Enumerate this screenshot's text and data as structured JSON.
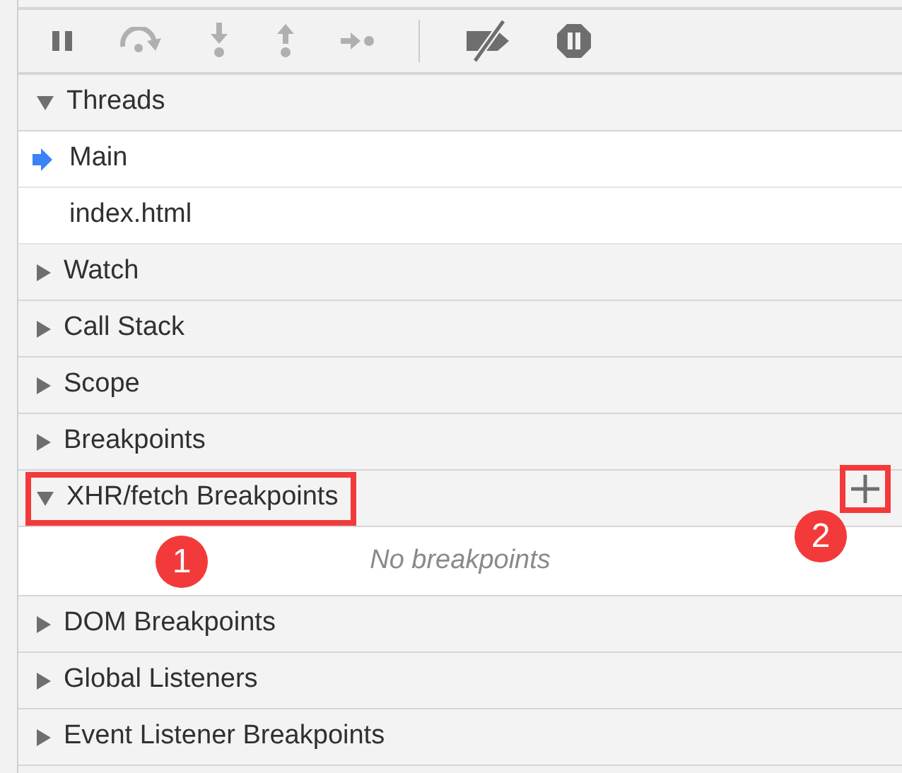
{
  "toolbar": [
    [
      {
        "kind": "pause",
        "disabled": false
      },
      {
        "kind": "step-over",
        "disabled": true
      },
      {
        "kind": "step-into",
        "disabled": true
      },
      {
        "kind": "step-out",
        "disabled": true
      },
      {
        "kind": "step",
        "disabled": true
      }
    ],
    [
      {
        "kind": "deactivate",
        "disabled": false
      },
      {
        "kind": "pause-exceptions",
        "disabled": false
      }
    ]
  ],
  "sections": [
    {
      "title": "Threads",
      "expanded": true,
      "items": [
        {
          "label": "Main",
          "selected": true
        },
        {
          "label": "index.html",
          "selected": false
        }
      ]
    },
    {
      "title": "Watch",
      "expanded": false
    },
    {
      "title": "Call Stack",
      "expanded": false
    },
    {
      "title": "Scope",
      "expanded": false
    },
    {
      "title": "Breakpoints",
      "expanded": false
    },
    {
      "title": "XHR/fetch Breakpoints",
      "expanded": true,
      "highlighted": true,
      "callout": "1",
      "empty_text": "No breakpoints",
      "add_button": {
        "highlighted": true,
        "callout": "2"
      }
    },
    {
      "title": "DOM Breakpoints",
      "expanded": false
    },
    {
      "title": "Global Listeners",
      "expanded": false
    },
    {
      "title": "Event Listener Breakpoints",
      "expanded": false
    }
  ]
}
